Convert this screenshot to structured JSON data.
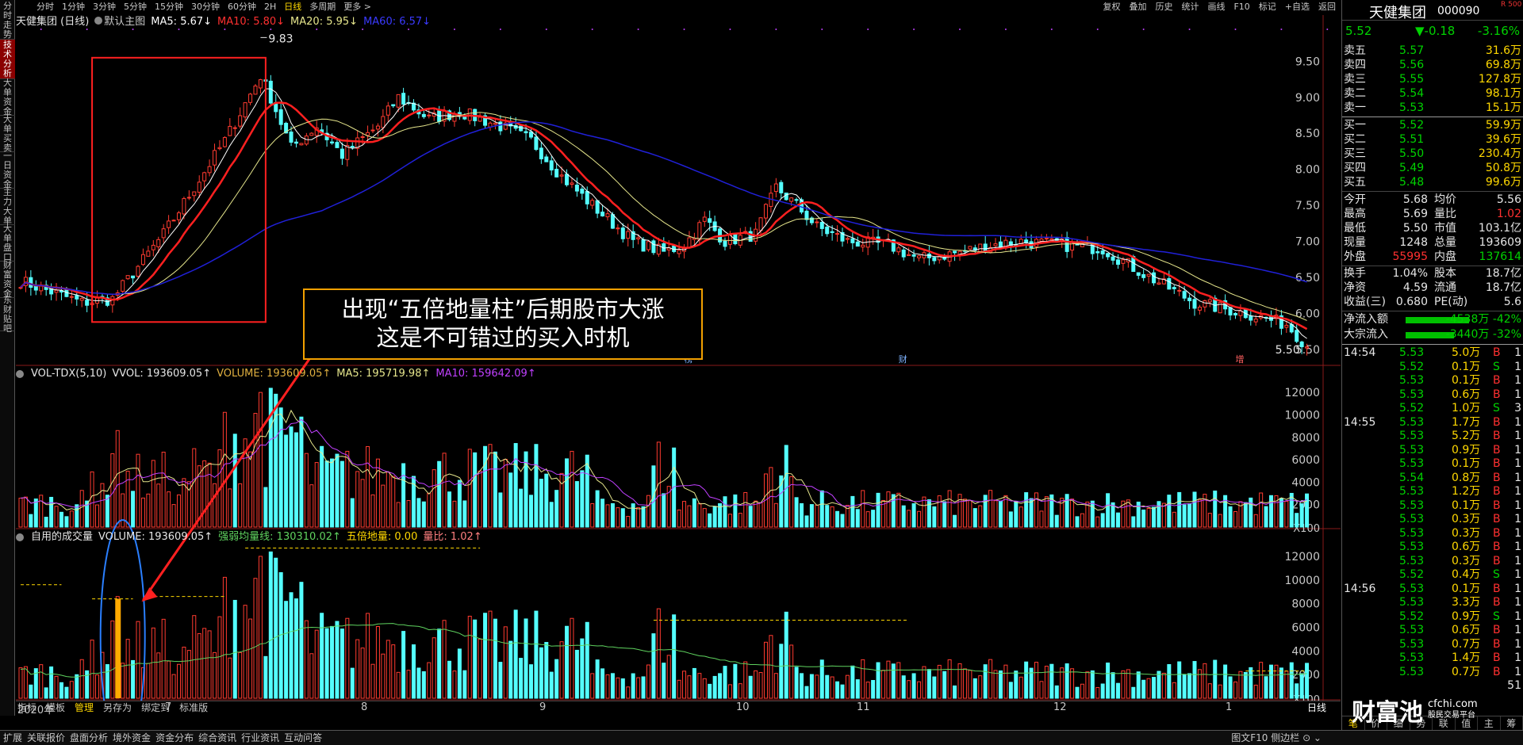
{
  "left_tabs": [
    {
      "label": "分时走势",
      "active": false
    },
    {
      "label": "技术分析",
      "active": true
    },
    {
      "label": "大单资金",
      "active": false
    },
    {
      "label": "大单买卖",
      "active": false
    },
    {
      "label": "一日资金",
      "active": false
    },
    {
      "label": "主力大单",
      "active": false
    },
    {
      "label": "大单盘口",
      "active": false
    },
    {
      "label": "财富资金",
      "active": false
    },
    {
      "label": "东财贴吧",
      "active": false
    }
  ],
  "periods": [
    "分时",
    "1分钟",
    "3分钟",
    "5分钟",
    "15分钟",
    "30分钟",
    "60分钟",
    "2H",
    "日线",
    "多周期",
    "更多 >"
  ],
  "active_period": "日线",
  "toolbar_right": [
    "复权",
    "叠加",
    "历史",
    "统计",
    "画线",
    "F10",
    "标记",
    "+自选",
    "返回"
  ],
  "main_legend": {
    "title": "天健集团 (日线)",
    "indicator": "默认主图",
    "ma5": "MA5: 5.67↓",
    "ma10": "MA10: 5.80↓",
    "ma20": "MA20: 5.95↓",
    "ma60": "MA60: 6.57↓"
  },
  "vol_legend": {
    "name": "VOL-TDX(5,10)",
    "vvol": "VVOL: 193609.05↑",
    "volume": "VOLUME: 193609.05↑",
    "ma5": "MA5: 195719.98↑",
    "ma10": "MA10: 159642.09↑"
  },
  "custom_legend": {
    "name": "自用的成交量",
    "volume": "VOLUME: 193609.05↑",
    "weak": "强弱均量线: 130310.02↑",
    "five": "五倍地量: 0.00",
    "ratio": "量比: 1.02↑"
  },
  "callout": {
    "line1": "出现“五倍地量柱”后期股市大涨",
    "line2": "这是不可错过的买入时机"
  },
  "markers": [
    "榜",
    "财",
    "增"
  ],
  "x_labels": [
    "2020年",
    "7",
    "8",
    "9",
    "10",
    "11",
    "12",
    "1"
  ],
  "bottom_tabs": [
    "指标",
    "模板",
    "管理",
    "另存为",
    "绑定到",
    "标准版"
  ],
  "bottom_right": "日线",
  "bottom_bar": [
    "扩展",
    "关联报价",
    "盘面分析",
    "境外资金",
    "资金分布",
    "综合资讯",
    "行业资讯",
    "互动问答"
  ],
  "bottom_bar_right": "图文F10 侧边栏 ⊙ ⌄",
  "colors": {
    "up": "#ff3b30",
    "down": "#54ffff",
    "ma5": "#ffffff",
    "ma10": "#ff2020",
    "ma20": "#e6e68c",
    "ma60": "#2020d8",
    "weak": "#5fd35f"
  },
  "chart_data": [
    {
      "type": "candlestick",
      "title": "天健集团 (日线)",
      "ylim": [
        5.3,
        9.9
      ],
      "y_ticks": [
        "9.50",
        "9.00",
        "8.50",
        "8.00",
        "7.50",
        "7.00",
        "6.50",
        "6.00",
        "5.50"
      ],
      "high_label": "9.83",
      "low_label": "5.50",
      "ma_last": {
        "MA5": 5.67,
        "MA10": 5.8,
        "MA20": 5.95,
        "MA60": 6.57
      }
    },
    {
      "type": "bar",
      "title": "VOL-TDX(5,10)",
      "ylim": [
        0,
        13000
      ],
      "y_ticks": [
        "12000",
        "10000",
        "8000",
        "6000",
        "4000",
        "2000"
      ],
      "unit": "X100",
      "last": 193609.05,
      "ma5": 195719.98,
      "ma10": 159642.09
    },
    {
      "type": "bar",
      "title": "自用的成交量",
      "ylim": [
        0,
        13000
      ],
      "y_ticks": [
        "12000",
        "10000",
        "8000",
        "6000",
        "4000",
        "2000"
      ],
      "unit": "X100",
      "strong_weak_avg": 130310.02,
      "five_times_floor": 0.0,
      "volume_ratio": 1.02
    }
  ],
  "quote": {
    "name": "天健集团",
    "code": "000090",
    "badge": "R 500",
    "price": "5.52",
    "change": "▼-0.18",
    "pct": "-3.16%",
    "asks": [
      {
        "l": "卖五",
        "p": "5.57",
        "v": "31.6万"
      },
      {
        "l": "卖四",
        "p": "5.56",
        "v": "69.8万"
      },
      {
        "l": "卖三",
        "p": "5.55",
        "v": "127.8万"
      },
      {
        "l": "卖二",
        "p": "5.54",
        "v": "98.1万"
      },
      {
        "l": "卖一",
        "p": "5.53",
        "v": "15.1万"
      }
    ],
    "bids": [
      {
        "l": "买一",
        "p": "5.52",
        "v": "59.9万"
      },
      {
        "l": "买二",
        "p": "5.51",
        "v": "39.6万"
      },
      {
        "l": "买三",
        "p": "5.50",
        "v": "230.4万"
      },
      {
        "l": "买四",
        "p": "5.49",
        "v": "50.8万"
      },
      {
        "l": "买五",
        "p": "5.48",
        "v": "99.6万"
      }
    ],
    "stats": [
      {
        "a": "今开",
        "av": "5.68",
        "b": "均价",
        "bv": "5.56"
      },
      {
        "a": "最高",
        "av": "5.69",
        "b": "量比",
        "bv": "1.02"
      },
      {
        "a": "最低",
        "av": "5.50",
        "b": "市值",
        "bv": "103.1亿"
      },
      {
        "a": "现量",
        "av": "1248",
        "b": "总量",
        "bv": "193609"
      },
      {
        "a": "外盘",
        "av": "55995",
        "b": "内盘",
        "bv": "137614"
      },
      {
        "a": "换手",
        "av": "1.04%",
        "b": "股本",
        "bv": "18.7亿"
      },
      {
        "a": "净资",
        "av": "4.59",
        "b": "流通",
        "bv": "18.7亿"
      },
      {
        "a": "收益(三)",
        "av": "0.680",
        "b": "PE(动)",
        "bv": "5.6"
      }
    ],
    "flows": [
      {
        "l": "净流入额",
        "v": "-4538万 -42%",
        "pct": 42
      },
      {
        "l": "大宗流入",
        "v": "-3440万 -32%",
        "pct": 32
      }
    ]
  },
  "ticks": [
    {
      "t": "14:54",
      "p": "5.53",
      "v": "5.0万",
      "s": "B",
      "n": "1"
    },
    {
      "t": "",
      "p": "5.52",
      "v": "0.1万",
      "s": "S",
      "n": "1"
    },
    {
      "t": "",
      "p": "5.53",
      "v": "0.1万",
      "s": "B",
      "n": "1"
    },
    {
      "t": "",
      "p": "5.53",
      "v": "0.6万",
      "s": "B",
      "n": "1"
    },
    {
      "t": "",
      "p": "5.52",
      "v": "1.0万",
      "s": "S",
      "n": "3"
    },
    {
      "t": "14:55",
      "p": "5.53",
      "v": "1.7万",
      "s": "B",
      "n": "1"
    },
    {
      "t": "",
      "p": "5.53",
      "v": "5.2万",
      "s": "B",
      "n": "1"
    },
    {
      "t": "",
      "p": "5.53",
      "v": "0.9万",
      "s": "B",
      "n": "1"
    },
    {
      "t": "",
      "p": "5.53",
      "v": "0.1万",
      "s": "B",
      "n": "1"
    },
    {
      "t": "",
      "p": "5.54",
      "v": "0.8万",
      "s": "B",
      "n": "1"
    },
    {
      "t": "",
      "p": "5.53",
      "v": "1.2万",
      "s": "B",
      "n": "1"
    },
    {
      "t": "",
      "p": "5.53",
      "v": "0.1万",
      "s": "B",
      "n": "1"
    },
    {
      "t": "",
      "p": "5.53",
      "v": "0.3万",
      "s": "B",
      "n": "1"
    },
    {
      "t": "",
      "p": "5.53",
      "v": "0.3万",
      "s": "B",
      "n": "1"
    },
    {
      "t": "",
      "p": "5.53",
      "v": "0.6万",
      "s": "B",
      "n": "1"
    },
    {
      "t": "",
      "p": "5.53",
      "v": "0.3万",
      "s": "B",
      "n": "1"
    },
    {
      "t": "",
      "p": "5.52",
      "v": "0.4万",
      "s": "S",
      "n": "1"
    },
    {
      "t": "14:56",
      "p": "5.53",
      "v": "0.1万",
      "s": "B",
      "n": "1"
    },
    {
      "t": "",
      "p": "5.53",
      "v": "3.3万",
      "s": "B",
      "n": "1"
    },
    {
      "t": "",
      "p": "5.52",
      "v": "0.9万",
      "s": "S",
      "n": "1"
    },
    {
      "t": "",
      "p": "5.53",
      "v": "0.6万",
      "s": "B",
      "n": "1"
    },
    {
      "t": "",
      "p": "5.53",
      "v": "0.7万",
      "s": "B",
      "n": "1"
    },
    {
      "t": "",
      "p": "5.53",
      "v": "1.4万",
      "s": "B",
      "n": "1"
    },
    {
      "t": "",
      "p": "5.53",
      "v": "0.7万",
      "s": "B",
      "n": "1"
    },
    {
      "t": "",
      "p": "",
      "v": "",
      "s": "",
      "n": "51"
    }
  ],
  "right_tabs": [
    "笔",
    "价",
    "细",
    "势",
    "联",
    "值",
    "主",
    "筹"
  ],
  "watermark": {
    "big": "财富池",
    "site": "cfchi.com",
    "sub": "股民交易平台"
  }
}
